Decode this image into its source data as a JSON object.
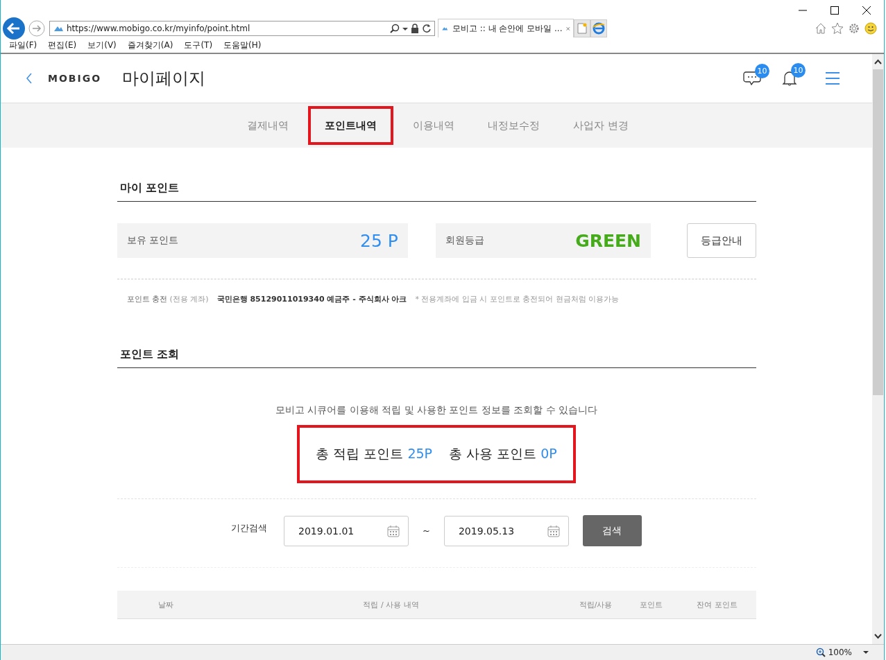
{
  "browser": {
    "url": "https://www.mobigo.co.kr/myinfo/point.html",
    "tab_title": "모비고 :: 내 손안에 모바일 ...",
    "menu": [
      "파일(F)",
      "편집(E)",
      "보기(V)",
      "즐겨찾기(A)",
      "도구(T)",
      "도움말(H)"
    ],
    "zoom": "100%"
  },
  "header": {
    "logo": "MOBIGO",
    "title": "마이페이지",
    "chat_badge": "10",
    "bell_badge": "10"
  },
  "tabs": [
    {
      "label": "결제내역",
      "selected": false,
      "highlighted": false
    },
    {
      "label": "포인트내역",
      "selected": true,
      "highlighted": true
    },
    {
      "label": "이용내역",
      "selected": false,
      "highlighted": false
    },
    {
      "label": "내정보수정",
      "selected": false,
      "highlighted": false
    },
    {
      "label": "사업자 변경",
      "selected": false,
      "highlighted": false
    }
  ],
  "my_point": {
    "heading": "마이 포인트",
    "held_label": "보유 포인트",
    "held_value": "25 P",
    "grade_label": "회원등급",
    "grade_value": "GREEN",
    "grade_button": "등급안내",
    "charge_label": "포인트 충전",
    "charge_sub": "(전용 계좌)",
    "account": "국민은행 85129011019340 예금주 - 주식회사 아크",
    "note": "* 전용계좌에 입금 시 포인트로 충전되어 현금처럼 이용가능"
  },
  "lookup": {
    "heading": "포인트 조회",
    "description": "모비고 시큐어를 이용해 적립 및 사용한 포인트 정보를 조회할 수 있습니다",
    "highlighted": true,
    "totals": [
      {
        "label": "총 적립 포인트",
        "value": "25P"
      },
      {
        "label": "총 사용 포인트",
        "value": "0P"
      }
    ],
    "period_label": "기간검색",
    "start_date": "2019.01.01",
    "separator": "~",
    "end_date": "2019.05.13",
    "search_button": "검색"
  },
  "table": {
    "columns": [
      "날짜",
      "적립 / 사용 내역",
      "적립/사용",
      "포인트",
      "잔여 포인트"
    ]
  }
}
